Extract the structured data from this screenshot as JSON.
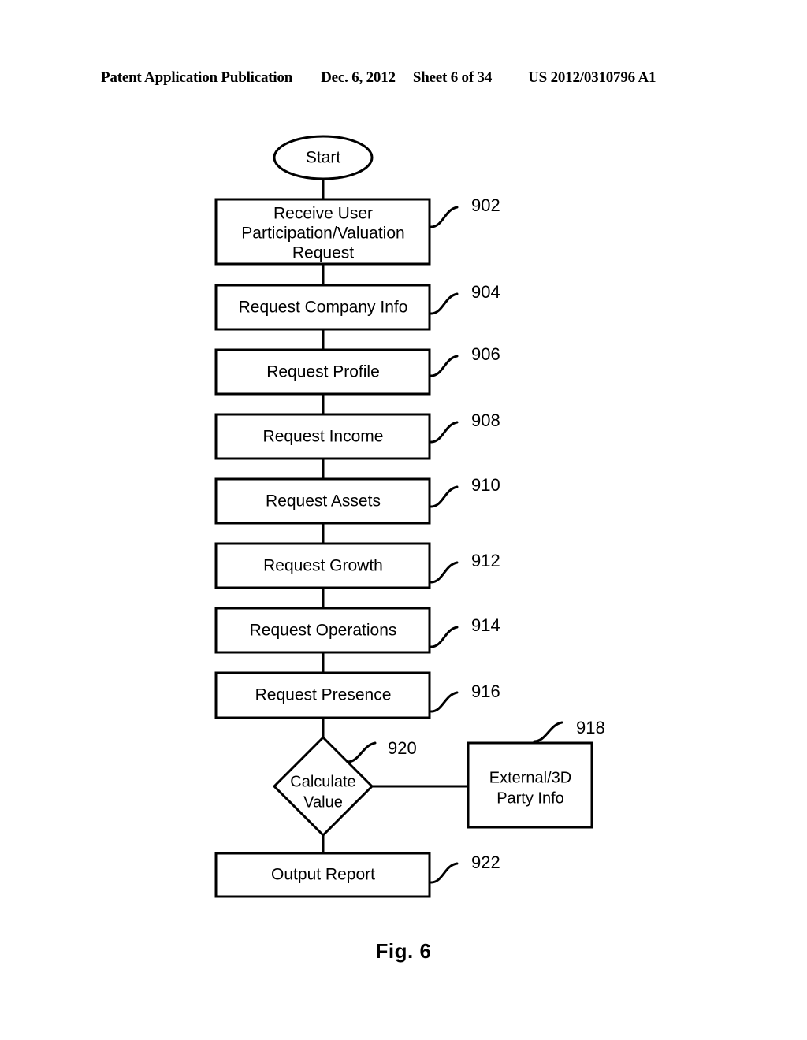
{
  "header": {
    "publication": "Patent Application Publication",
    "date": "Dec. 6, 2012",
    "sheet": "Sheet 6 of 34",
    "patent_number": "US 2012/0310796 A1"
  },
  "figure": {
    "caption": "Fig. 6",
    "start_label": "Start",
    "nodes": [
      {
        "id": "n902",
        "ref": "902",
        "shape": "process",
        "lines": [
          "Receive User",
          "Participation/Valuation",
          "Request"
        ]
      },
      {
        "id": "n904",
        "ref": "904",
        "shape": "process",
        "lines": [
          "Request Company Info"
        ]
      },
      {
        "id": "n906",
        "ref": "906",
        "shape": "process",
        "lines": [
          "Request Profile"
        ]
      },
      {
        "id": "n908",
        "ref": "908",
        "shape": "process",
        "lines": [
          "Request Income"
        ]
      },
      {
        "id": "n910",
        "ref": "910",
        "shape": "process",
        "lines": [
          "Request Assets"
        ]
      },
      {
        "id": "n912",
        "ref": "912",
        "shape": "process",
        "lines": [
          "Request Growth"
        ]
      },
      {
        "id": "n914",
        "ref": "914",
        "shape": "process",
        "lines": [
          "Request Operations"
        ]
      },
      {
        "id": "n916",
        "ref": "916",
        "shape": "process",
        "lines": [
          "Request Presence"
        ]
      },
      {
        "id": "n920",
        "ref": "920",
        "shape": "decision",
        "lines": [
          "Calculate",
          "Value"
        ]
      },
      {
        "id": "n918",
        "ref": "918",
        "shape": "process",
        "lines": [
          "External/3D",
          "Party Info"
        ]
      },
      {
        "id": "n922",
        "ref": "922",
        "shape": "process",
        "lines": [
          "Output Report"
        ]
      }
    ]
  },
  "colors": {
    "ink": "#000000",
    "paper": "#ffffff"
  }
}
